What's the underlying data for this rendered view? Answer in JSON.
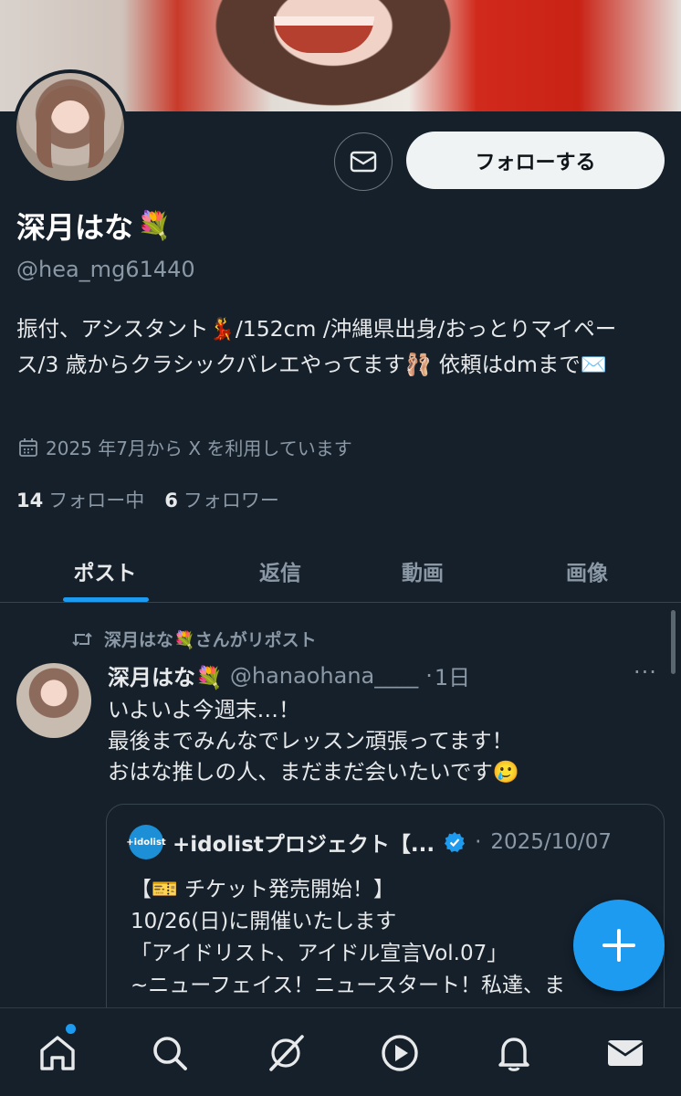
{
  "profile": {
    "name": "深月はな",
    "name_emoji": "💐",
    "handle": "@hea_mg61440",
    "bio": "振付、アシスタント💃/152cm /沖縄県出身/おっとりマイペース/3 歳からクラシックバレエやってます🩰 依頼はdmまで✉️",
    "joined": "2025 年7月から X を利用しています",
    "following_count": "14",
    "following_label": "フォロー中",
    "followers_count": "6",
    "followers_label": "フォロワー",
    "follow_button": "フォローする"
  },
  "tabs": [
    "ポスト",
    "返信",
    "動画",
    "画像"
  ],
  "active_tab": "ポスト",
  "post": {
    "repost_label": "深月はな💐さんがリポスト",
    "author_name": "深月はな💐",
    "author_handle": "@hanaohana____",
    "separator": "·",
    "time": "1日",
    "more": "···",
    "lines": [
      "いよいよ今週末…！",
      "最後までみんなでレッスン頑張ってます！",
      "おはな推しの人、まだまだ会いたいです🥲"
    ],
    "quote": {
      "logo_text": "+idolist",
      "author": "+idolistプロジェクト【...",
      "separator": "·",
      "date": "2025/10/07",
      "lines": [
        "【🎫 チケット発売開始！】",
        "10/26(日)に開催いたします",
        "「アイドリスト、アイドル宣言Vol.07」",
        "~ニューフェイス！ニュースタート！私達、ま"
      ]
    }
  },
  "fab_label": "+",
  "colors": {
    "background": "#15202b",
    "accent": "#1d9bf0",
    "muted": "#8b98a5",
    "divider": "#38444d"
  },
  "nav": [
    "home-icon",
    "search-icon",
    "grok-icon",
    "video-icon",
    "notifications-icon",
    "messages-icon"
  ]
}
